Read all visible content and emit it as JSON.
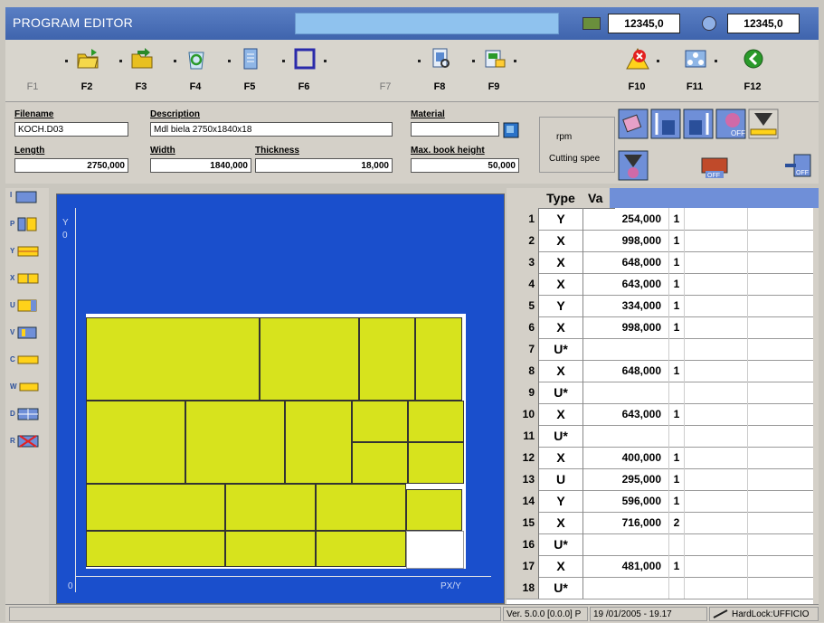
{
  "title": "PROGRAM EDITOR",
  "counters": [
    "12345,0",
    "12345,0"
  ],
  "function_keys": [
    {
      "label": "F1",
      "enabled": false,
      "icon": "none"
    },
    {
      "label": "F2",
      "enabled": true,
      "icon": "open-folder-icon"
    },
    {
      "label": "F3",
      "enabled": true,
      "icon": "folder-arrow-icon"
    },
    {
      "label": "F4",
      "enabled": true,
      "icon": "recycle-icon"
    },
    {
      "label": "F5",
      "enabled": true,
      "icon": "document-icon"
    },
    {
      "label": "F6",
      "enabled": true,
      "icon": "frame-icon"
    },
    {
      "label": "F7",
      "enabled": false,
      "icon": "none"
    },
    {
      "label": "F8",
      "enabled": true,
      "icon": "print-preview-icon"
    },
    {
      "label": "F9",
      "enabled": true,
      "icon": "export-icon"
    },
    {
      "label": "F10",
      "enabled": true,
      "icon": "warning-icon"
    },
    {
      "label": "F11",
      "enabled": true,
      "icon": "network-icon"
    },
    {
      "label": "F12",
      "enabled": true,
      "icon": "back-icon"
    }
  ],
  "fields": {
    "filename_label": "Filename",
    "filename": "KOCH.D03",
    "description_label": "Description",
    "description": "Mdl biela 2750x1840x18",
    "material_label": "Material",
    "material": "",
    "length_label": "Length",
    "length": "2750,000",
    "width_label": "Width",
    "width": "1840,000",
    "thickness_label": "Thickness",
    "thickness": "18,000",
    "max_book_label": "Max. book height",
    "max_book": "50,000"
  },
  "rpm_label": "rpm",
  "cutting_speed_label": "Cutting spee",
  "off_label": "OFF",
  "canvas": {
    "y_label": "Y",
    "y_zero": "0",
    "x_zero": "0",
    "x_label": "PX/Y"
  },
  "table": {
    "headers": [
      "Type",
      "Va"
    ],
    "rows": [
      {
        "n": "1",
        "type": "Y",
        "value": "254,000",
        "qty": "1"
      },
      {
        "n": "2",
        "type": "X",
        "value": "998,000",
        "qty": "1"
      },
      {
        "n": "3",
        "type": "X",
        "value": "648,000",
        "qty": "1"
      },
      {
        "n": "4",
        "type": "X",
        "value": "643,000",
        "qty": "1"
      },
      {
        "n": "5",
        "type": "Y",
        "value": "334,000",
        "qty": "1"
      },
      {
        "n": "6",
        "type": "X",
        "value": "998,000",
        "qty": "1"
      },
      {
        "n": "7",
        "type": "U*",
        "value": "",
        "qty": ""
      },
      {
        "n": "8",
        "type": "X",
        "value": "648,000",
        "qty": "1"
      },
      {
        "n": "9",
        "type": "U*",
        "value": "",
        "qty": ""
      },
      {
        "n": "10",
        "type": "X",
        "value": "643,000",
        "qty": "1"
      },
      {
        "n": "11",
        "type": "U*",
        "value": "",
        "qty": ""
      },
      {
        "n": "12",
        "type": "X",
        "value": "400,000",
        "qty": "1"
      },
      {
        "n": "13",
        "type": "U",
        "value": "295,000",
        "qty": "1"
      },
      {
        "n": "14",
        "type": "Y",
        "value": "596,000",
        "qty": "1"
      },
      {
        "n": "15",
        "type": "X",
        "value": "716,000",
        "qty": "2"
      },
      {
        "n": "16",
        "type": "U*",
        "value": "",
        "qty": ""
      },
      {
        "n": "17",
        "type": "X",
        "value": "481,000",
        "qty": "1"
      },
      {
        "n": "18",
        "type": "U*",
        "value": "",
        "qty": ""
      }
    ]
  },
  "status": {
    "version": "Ver. 5.0.0 [0.0.0] P",
    "datetime": "19 /01/2005 - 19.17",
    "hardlock": "HardLock:UFFICIO"
  },
  "colors": {
    "title": "#4a70b8",
    "canvas": "#1a4fcc",
    "piece": "#d7e31d"
  }
}
